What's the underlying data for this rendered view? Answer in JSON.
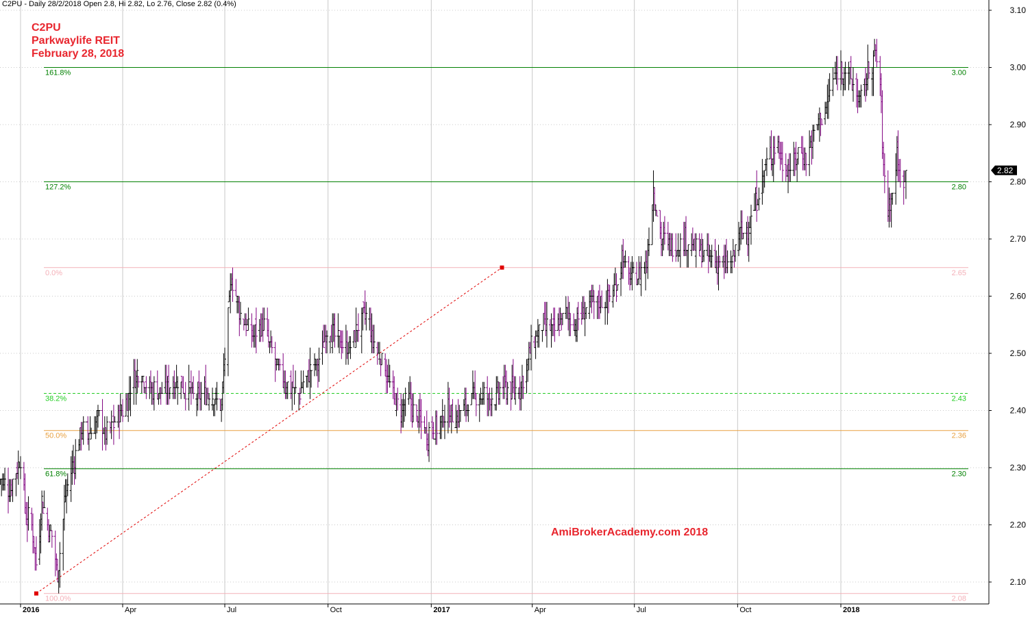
{
  "header": {
    "text": "C2PU - Daily 28/2/2018 Open 2.8, Hi 2.82, Lo 2.76, Close 2.82 (0.4%)"
  },
  "title": {
    "line1": "C2PU",
    "line2": "Parkwaylife REIT",
    "line3": "February 28, 2018"
  },
  "watermark": "AmiBrokerAcademy.com  2018",
  "colors": {
    "title": "#e8262e",
    "up_bar": "#000000",
    "down_bar": "#800080",
    "fib_green": "#008000",
    "fib_lightgreen": "#22cc22",
    "fib_orange": "#e8a040",
    "fib_pink": "#f4b0b8",
    "trend_red": "#e00000",
    "grid": "#c8c8c8"
  },
  "chart_data": {
    "type": "ohlc",
    "symbol": "C2PU",
    "ylim": [
      2.055,
      3.11
    ],
    "y_ticks": [
      "2.10",
      "2.20",
      "2.30",
      "2.40",
      "2.50",
      "2.60",
      "2.70",
      "2.80",
      "2.90",
      "3.00",
      "3.10"
    ],
    "x_range": [
      "2015-12-14",
      "2018-03-31"
    ],
    "x_ticks": [
      {
        "label": "2016",
        "date": "2016-01-01",
        "bold": true
      },
      {
        "label": "Apr",
        "date": "2016-04-01",
        "bold": false
      },
      {
        "label": "Jul",
        "date": "2016-07-01",
        "bold": false
      },
      {
        "label": "Oct",
        "date": "2016-10-01",
        "bold": false
      },
      {
        "label": "2017",
        "date": "2017-01-01",
        "bold": true
      },
      {
        "label": "Apr",
        "date": "2017-04-01",
        "bold": false
      },
      {
        "label": "Jul",
        "date": "2017-07-01",
        "bold": false
      },
      {
        "label": "Oct",
        "date": "2017-10-01",
        "bold": false
      },
      {
        "label": "2018",
        "date": "2018-01-01",
        "bold": true
      }
    ],
    "last_price_label": "2.82",
    "last_close": 2.82,
    "fibonacci_levels": [
      {
        "label": "161.8%",
        "value_label": "3.00",
        "value": 3.0,
        "color": "#008000",
        "style": "solid"
      },
      {
        "label": "127.2%",
        "value_label": "2.80",
        "value": 2.8,
        "color": "#008000",
        "style": "solid"
      },
      {
        "label": "0.0%",
        "value_label": "2.65",
        "value": 2.65,
        "color": "#f4b0b8",
        "style": "solid"
      },
      {
        "label": "38.2%",
        "value_label": "2.43",
        "value": 2.43,
        "color": "#22cc22",
        "style": "dashed"
      },
      {
        "label": "50.0%",
        "value_label": "2.36",
        "value": 2.365,
        "color": "#e8a040",
        "style": "solid"
      },
      {
        "label": "61.8%",
        "value_label": "2.30",
        "value": 2.298,
        "color": "#008000",
        "style": "solid"
      },
      {
        "label": "100.0%",
        "value_label": "2.08",
        "value": 2.08,
        "color": "#f4b0b8",
        "style": "solid"
      }
    ],
    "trendline": {
      "from": {
        "date": "2016-01-15",
        "value": 2.08
      },
      "to": {
        "date": "2017-03-05",
        "value": 2.65
      }
    },
    "price_anchors": [
      [
        "2015-12-14",
        2.28
      ],
      [
        "2015-12-22",
        2.26
      ],
      [
        "2016-01-01",
        2.32
      ],
      [
        "2016-01-06",
        2.21
      ],
      [
        "2016-01-10",
        2.22
      ],
      [
        "2016-01-15",
        2.13
      ],
      [
        "2016-01-20",
        2.24
      ],
      [
        "2016-01-25",
        2.2
      ],
      [
        "2016-01-29",
        2.18
      ],
      [
        "2016-02-03",
        2.11
      ],
      [
        "2016-02-10",
        2.25
      ],
      [
        "2016-02-18",
        2.32
      ],
      [
        "2016-02-25",
        2.37
      ],
      [
        "2016-03-03",
        2.36
      ],
      [
        "2016-03-10",
        2.39
      ],
      [
        "2016-03-16",
        2.36
      ],
      [
        "2016-03-22",
        2.37
      ],
      [
        "2016-04-01",
        2.4
      ],
      [
        "2016-04-10",
        2.45
      ],
      [
        "2016-04-16",
        2.47
      ],
      [
        "2016-04-25",
        2.44
      ],
      [
        "2016-05-05",
        2.43
      ],
      [
        "2016-05-20",
        2.45
      ],
      [
        "2016-06-05",
        2.42
      ],
      [
        "2016-06-20",
        2.43
      ],
      [
        "2016-06-28",
        2.41
      ],
      [
        "2016-07-02",
        2.52
      ],
      [
        "2016-07-07",
        2.63
      ],
      [
        "2016-07-15",
        2.57
      ],
      [
        "2016-07-25",
        2.53
      ],
      [
        "2016-08-05",
        2.55
      ],
      [
        "2016-08-15",
        2.48
      ],
      [
        "2016-08-25",
        2.45
      ],
      [
        "2016-09-05",
        2.43
      ],
      [
        "2016-09-15",
        2.47
      ],
      [
        "2016-09-22",
        2.48
      ],
      [
        "2016-10-01",
        2.55
      ],
      [
        "2016-10-10",
        2.52
      ],
      [
        "2016-10-20",
        2.51
      ],
      [
        "2016-10-28",
        2.55
      ],
      [
        "2016-11-05",
        2.57
      ],
      [
        "2016-11-10",
        2.52
      ],
      [
        "2016-11-20",
        2.48
      ],
      [
        "2016-11-25",
        2.44
      ],
      [
        "2016-12-05",
        2.4
      ],
      [
        "2016-12-12",
        2.42
      ],
      [
        "2016-12-20",
        2.39
      ],
      [
        "2016-12-28",
        2.36
      ],
      [
        "2017-01-05",
        2.37
      ],
      [
        "2017-01-15",
        2.4
      ],
      [
        "2017-01-25",
        2.39
      ],
      [
        "2017-02-05",
        2.42
      ],
      [
        "2017-02-15",
        2.43
      ],
      [
        "2017-02-25",
        2.42
      ],
      [
        "2017-03-05",
        2.44
      ],
      [
        "2017-03-15",
        2.43
      ],
      [
        "2017-03-25",
        2.46
      ],
      [
        "2017-04-01",
        2.52
      ],
      [
        "2017-04-10",
        2.55
      ],
      [
        "2017-04-20",
        2.54
      ],
      [
        "2017-05-01",
        2.57
      ],
      [
        "2017-05-10",
        2.55
      ],
      [
        "2017-05-20",
        2.58
      ],
      [
        "2017-06-05",
        2.59
      ],
      [
        "2017-06-15",
        2.62
      ],
      [
        "2017-06-20",
        2.67
      ],
      [
        "2017-06-25",
        2.63
      ],
      [
        "2017-07-05",
        2.64
      ],
      [
        "2017-07-12",
        2.66
      ],
      [
        "2017-07-18",
        2.79
      ],
      [
        "2017-07-25",
        2.7
      ],
      [
        "2017-08-05",
        2.69
      ],
      [
        "2017-08-15",
        2.7
      ],
      [
        "2017-08-25",
        2.68
      ],
      [
        "2017-09-05",
        2.67
      ],
      [
        "2017-09-15",
        2.66
      ],
      [
        "2017-09-25",
        2.65
      ],
      [
        "2017-10-01",
        2.7
      ],
      [
        "2017-10-10",
        2.72
      ],
      [
        "2017-10-20",
        2.78
      ],
      [
        "2017-10-28",
        2.84
      ],
      [
        "2017-11-05",
        2.87
      ],
      [
        "2017-11-10",
        2.83
      ],
      [
        "2017-11-18",
        2.82
      ],
      [
        "2017-11-25",
        2.86
      ],
      [
        "2017-12-01",
        2.84
      ],
      [
        "2017-12-10",
        2.9
      ],
      [
        "2017-12-18",
        2.92
      ],
      [
        "2017-12-25",
        2.98
      ],
      [
        "2018-01-02",
        3.0
      ],
      [
        "2018-01-10",
        2.98
      ],
      [
        "2018-01-18",
        2.94
      ],
      [
        "2018-01-25",
        2.99
      ],
      [
        "2018-02-01",
        3.02
      ],
      [
        "2018-02-05",
        2.97
      ],
      [
        "2018-02-08",
        2.82
      ],
      [
        "2018-02-12",
        2.76
      ],
      [
        "2018-02-16",
        2.78
      ],
      [
        "2018-02-20",
        2.85
      ],
      [
        "2018-02-24",
        2.78
      ],
      [
        "2018-02-28",
        2.82
      ]
    ]
  }
}
